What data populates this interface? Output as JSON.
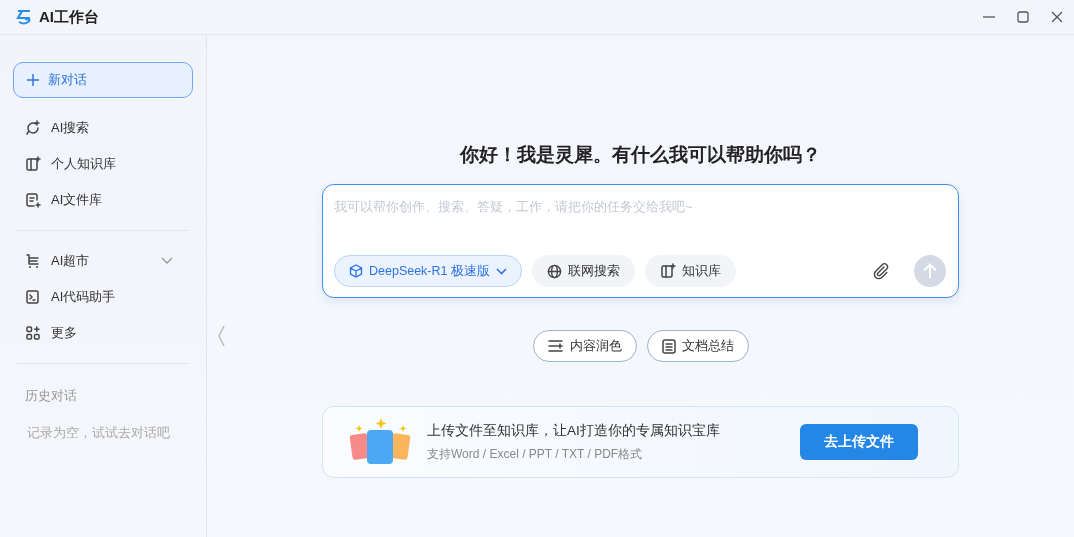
{
  "window": {
    "title": "AI工作台"
  },
  "sidebar": {
    "new_chat": "新对话",
    "groups": [
      [
        {
          "label": "AI搜索",
          "kind": "link"
        },
        {
          "label": "个人知识库",
          "kind": "link"
        },
        {
          "label": "AI文件库",
          "kind": "link"
        }
      ],
      [
        {
          "label": "AI超市",
          "kind": "expandable",
          "expanded": false
        },
        {
          "label": "AI代码助手",
          "kind": "link"
        },
        {
          "label": "更多",
          "kind": "link"
        }
      ]
    ],
    "history_title": "历史对话",
    "history_empty": "记录为空，试试去对话吧"
  },
  "main": {
    "greeting": "你好！我是灵犀。有什么我可以帮助你吗？",
    "input": {
      "placeholder": "我可以帮你创作、搜索、答疑，工作，请把你的任务交给我吧~"
    },
    "model": "DeepSeek-R1 极速版",
    "toggles": [
      {
        "label": "联网搜索",
        "on": false
      },
      {
        "label": "知识库",
        "on": false
      }
    ],
    "send_disabled": true,
    "quick_actions": [
      "内容润色",
      "文档总结"
    ],
    "upload": {
      "title": "上传文件至知识库，让AI打造你的专属知识宝库",
      "subtitle": "支持Word / Excel / PPT / TXT / PDF格式",
      "button": "去上传文件"
    }
  }
}
